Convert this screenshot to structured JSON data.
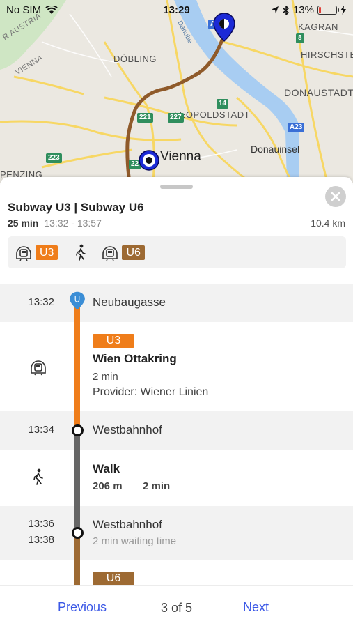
{
  "status_bar": {
    "carrier": "No SIM",
    "time": "13:29",
    "battery": "13%"
  },
  "map": {
    "labels": {
      "austria": "R AUSTRIA",
      "vienna_rot": "VIENNA",
      "dobling": "DÖBLING",
      "leopoldstadt": "LEOPOLDSTADT",
      "kagran": "KAGRAN",
      "hirschstetten": "HIRSCHSTE",
      "donaustadt": "DONAUSTADT",
      "donauinsel": "Donauinsel",
      "vienna": "Vienna",
      "penzing": "PENZING",
      "danube": "Danube"
    },
    "shields": {
      "s221": "221",
      "s227": "227",
      "s223": "223",
      "s14": "14",
      "s8": "8",
      "s23": "A23",
      "s22": "22",
      "sA": "A"
    },
    "colors": {
      "route": "#8f5a2a",
      "water": "#a8cdf2",
      "road": "#f7d764",
      "marker": "#1c2ad6"
    }
  },
  "sheet": {
    "title": "Subway U3 | Subway U6",
    "duration": "25 min",
    "time_range": "13:32 - 13:57",
    "distance": "10.4 km",
    "chips": [
      {
        "line": "U3",
        "color": "#ef7d1a"
      },
      {
        "line": "U6",
        "color": "#9d6a33"
      }
    ]
  },
  "timeline": {
    "stop1": {
      "time": "13:32",
      "name": "Neubaugasse",
      "pin": "U"
    },
    "seg1": {
      "line": "U3",
      "color": "#ef7d1a",
      "destination": "Wien Ottakring",
      "duration": "2 min",
      "provider": "Provider: Wiener Linien"
    },
    "stop2": {
      "time": "13:34",
      "name": "Westbahnhof"
    },
    "walk": {
      "title": "Walk",
      "distance": "206 m",
      "duration": "2 min"
    },
    "stop3": {
      "arrive": "13:36",
      "depart": "13:38",
      "name": "Westbahnhof",
      "waiting": "2 min waiting time"
    },
    "seg2": {
      "line": "U6",
      "color": "#9d6a33"
    },
    "walk_color": "#666666",
    "pin_color": "#3b8ed6"
  },
  "footer": {
    "previous": "Previous",
    "page": "3 of 5",
    "next": "Next"
  }
}
